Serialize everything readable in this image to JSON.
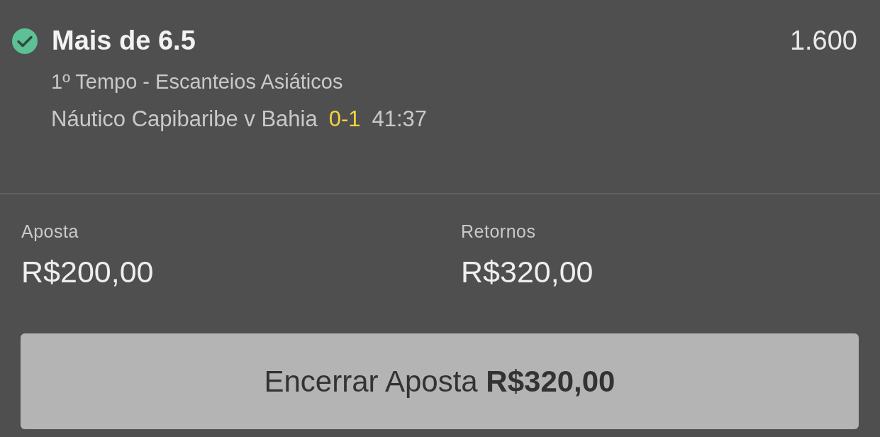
{
  "selection": {
    "won": true,
    "title": "Mais de 6.5",
    "odds": "1.600",
    "market": "1º Tempo - Escanteios Asiáticos",
    "event": "Náutico Capibaribe v Bahia",
    "score": "0-1",
    "clock": "41:37"
  },
  "stake": {
    "label": "Aposta",
    "value": "R$200,00"
  },
  "returns": {
    "label": "Retornos",
    "value": "R$320,00"
  },
  "cash_out_button": "Encerrar Aposta **R$320,00**"
}
